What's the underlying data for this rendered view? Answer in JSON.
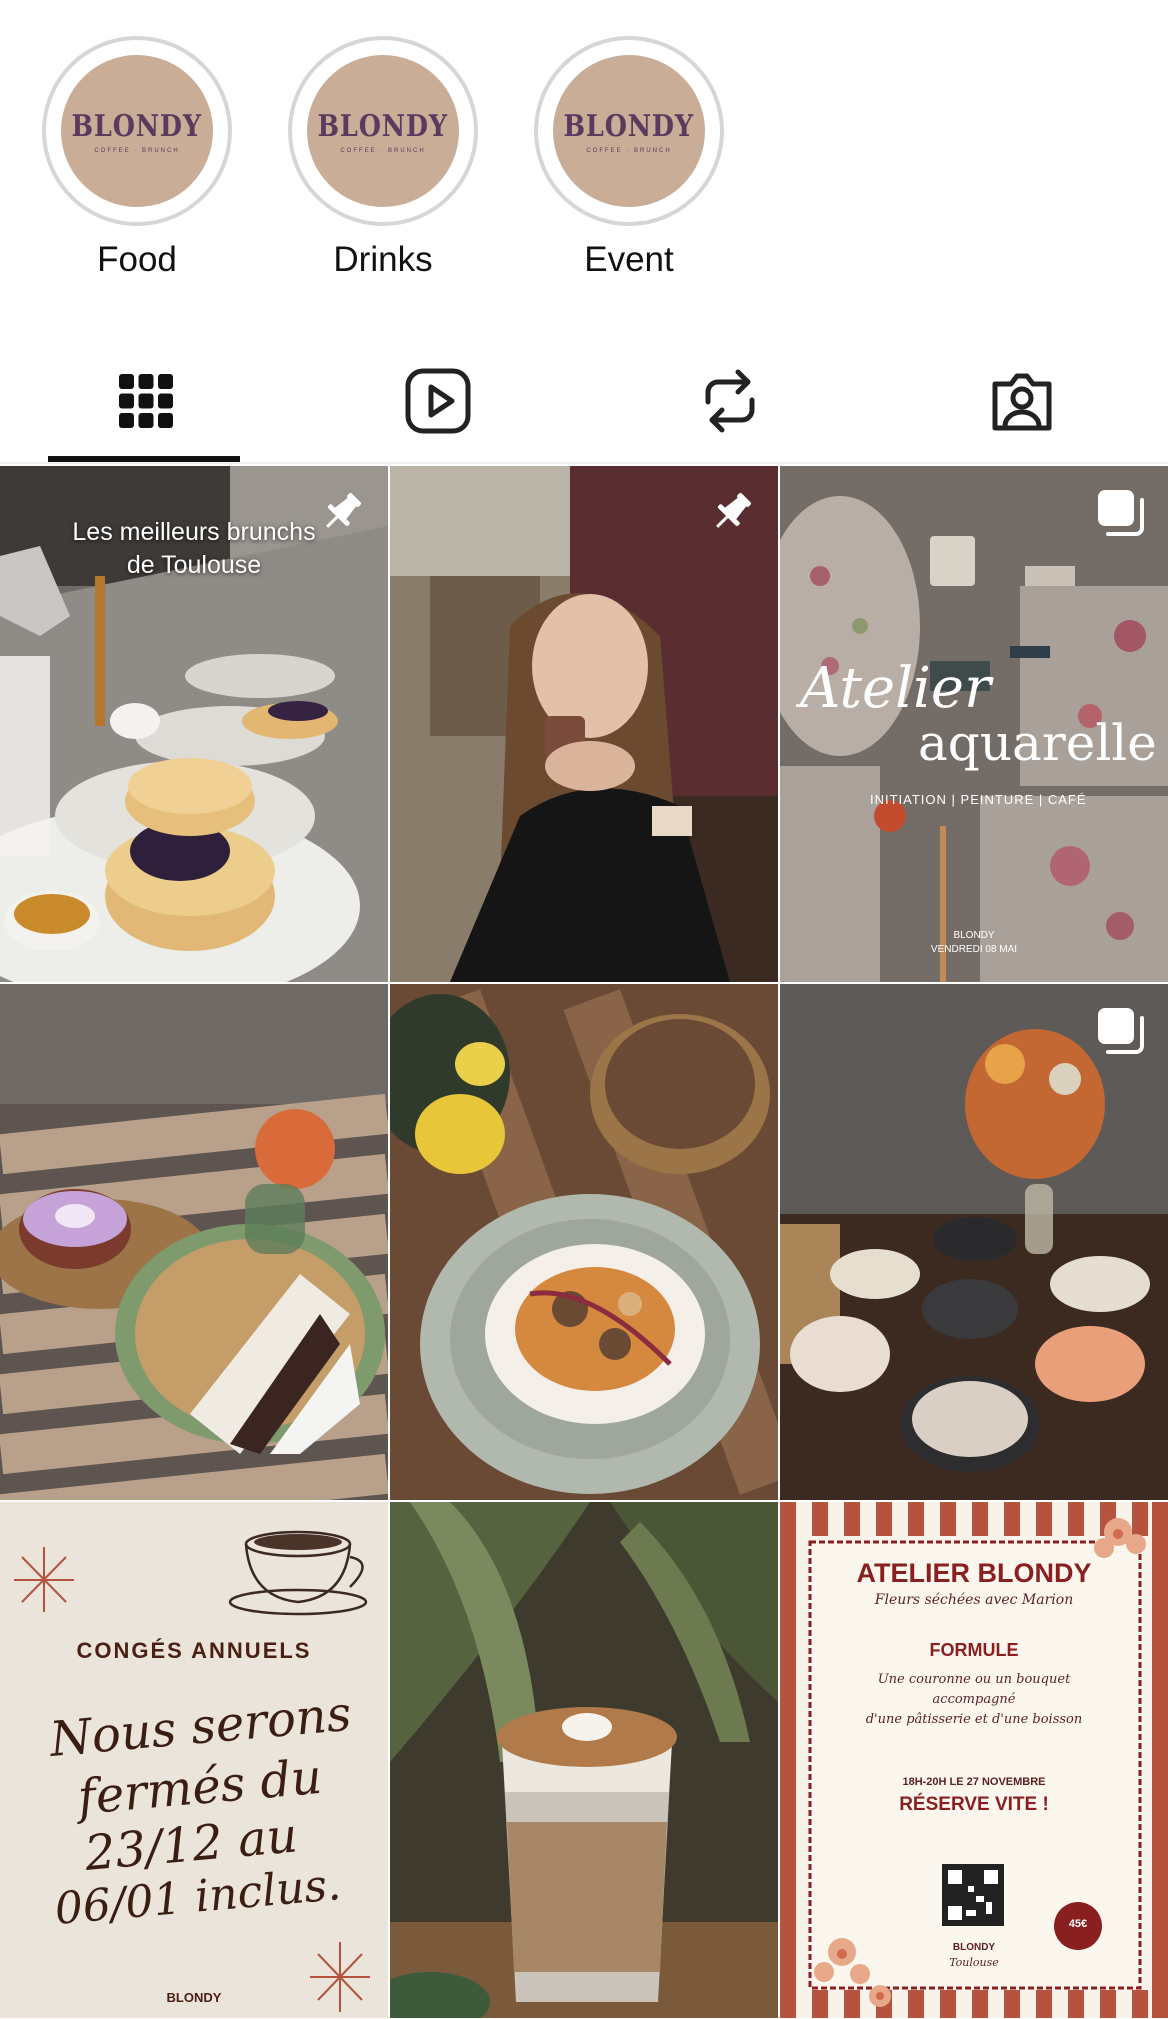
{
  "highlights": [
    {
      "label": "Food",
      "logo": "BLONDY",
      "logo_sub": "COFFEE · BRUNCH"
    },
    {
      "label": "Drinks",
      "logo": "BLONDY",
      "logo_sub": "COFFEE · BRUNCH"
    },
    {
      "label": "Event",
      "logo": "BLONDY",
      "logo_sub": "COFFEE · BRUNCH"
    }
  ],
  "tabs": [
    {
      "icon": "grid-icon",
      "active": true
    },
    {
      "icon": "reels-icon",
      "active": false
    },
    {
      "icon": "reposts-icon",
      "active": false
    },
    {
      "icon": "tagged-icon",
      "active": false
    }
  ],
  "posts": {
    "p1": {
      "caption_line1": "Les meilleurs brunchs",
      "caption_line2": "de Toulouse",
      "badge": "pin-icon"
    },
    "p2": {
      "badge": "pin-icon"
    },
    "p3": {
      "title1": "Atelier",
      "title2": "aquarelle",
      "subtitle": "INITIATION | PEINTURE | CAFÉ",
      "footer1": "BLONDY",
      "footer2": "VENDREDI 08 MAI",
      "badge": "carousel-icon"
    },
    "p4": {},
    "p5": {},
    "p6": {
      "badge": "carousel-icon"
    },
    "p7": {
      "heading": "CONGÉS ANNUELS",
      "line1": "Nous serons",
      "line2": "fermés du",
      "line3": "23/12 au",
      "line4": "06/01 inclus.",
      "footer": "BLONDY"
    },
    "p8": {},
    "p9": {
      "title": "ATELIER BLONDY",
      "subtitle": "Fleurs séchées avec Marion",
      "formule": "FORMULE",
      "desc1": "Une couronne ou un bouquet",
      "desc2": "accompagné",
      "desc3": "d'une pâtisserie et d'une boisson",
      "time": "18H-20H LE 27 NOVEMBRE",
      "cta": "RÉSERVE VITE !",
      "price": "45€",
      "footer1": "BLONDY",
      "footer2": "Toulouse"
    }
  },
  "colors": {
    "accent": "#111111",
    "logo_bg": "#c9ad97",
    "logo_text": "#5a3a5e",
    "brown": "#4a1f14",
    "rust": "#b5533e"
  }
}
